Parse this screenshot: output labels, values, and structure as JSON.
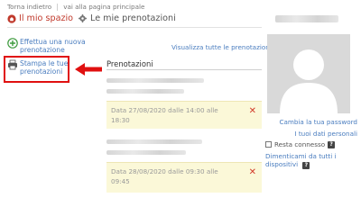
{
  "topnav": {
    "back": "Torna indietro",
    "home": "vai alla pagina principale"
  },
  "title": {
    "main": "Il mio spazio",
    "sub": "Le mie prenotazioni",
    "icon": "home-icon"
  },
  "sidebar": {
    "add_label": "Effettua una nuova prenotazione",
    "print_label": "Stampa le tue prenotazioni"
  },
  "main": {
    "view_all": "Visualizza tutte le prenotazioni",
    "section_title": "Prenotazioni",
    "bookings": [
      {
        "text": "Data 27/08/2020 dalle 14:00 alle 18:30"
      },
      {
        "text": "Data 28/08/2020 dalle 09:30 alle 09:45"
      }
    ],
    "delete_symbol": "✕"
  },
  "profile": {
    "change_password": "Cambia la tua password",
    "personal_data": "I tuoi dati personali",
    "stay_connected": "Resta connesso",
    "help_symbol": "?",
    "forget_devices": "Dimenticami da tutti i dispositivi"
  },
  "colors": {
    "accent_red": "#c0392b",
    "link_blue": "#4a7dbf",
    "booking_bg": "#fbf8d8",
    "annotation_red": "#e01010"
  }
}
